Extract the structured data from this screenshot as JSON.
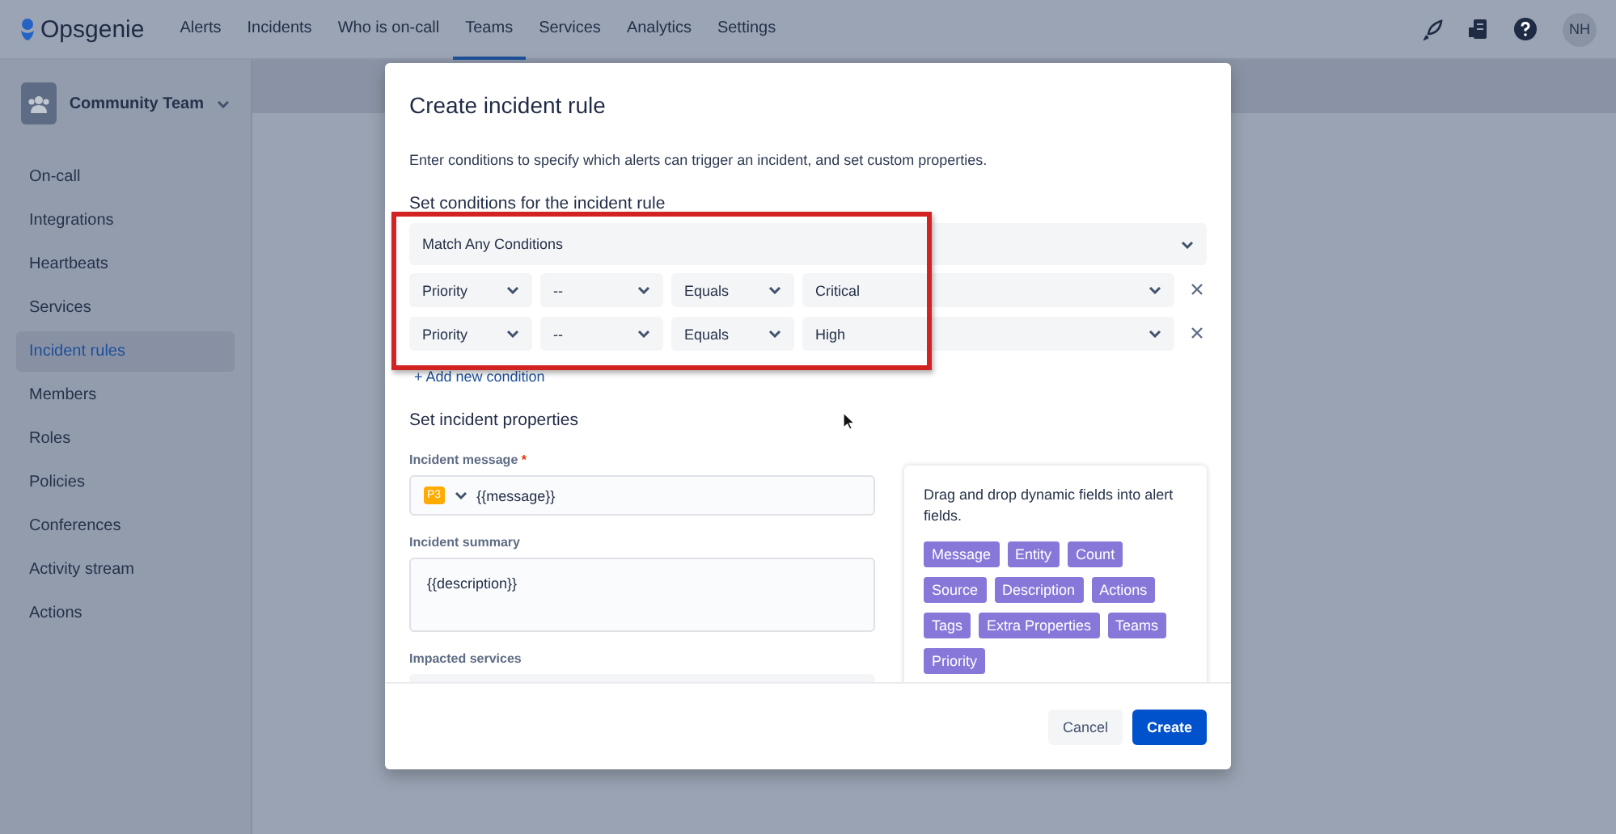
{
  "nav": {
    "brand": "Opsgenie",
    "items": [
      {
        "label": "Alerts",
        "selected": false
      },
      {
        "label": "Incidents",
        "selected": false
      },
      {
        "label": "Who is on-call",
        "selected": false
      },
      {
        "label": "Teams",
        "selected": true
      },
      {
        "label": "Services",
        "selected": false
      },
      {
        "label": "Analytics",
        "selected": false
      },
      {
        "label": "Settings",
        "selected": false
      }
    ],
    "avatar": "NH"
  },
  "sidebar": {
    "team": "Community Team",
    "items": [
      {
        "label": "On-call",
        "selected": false
      },
      {
        "label": "Integrations",
        "selected": false
      },
      {
        "label": "Heartbeats",
        "selected": false
      },
      {
        "label": "Services",
        "selected": false
      },
      {
        "label": "Incident rules",
        "selected": true
      },
      {
        "label": "Members",
        "selected": false
      },
      {
        "label": "Roles",
        "selected": false
      },
      {
        "label": "Policies",
        "selected": false
      },
      {
        "label": "Conferences",
        "selected": false
      },
      {
        "label": "Activity stream",
        "selected": false
      },
      {
        "label": "Actions",
        "selected": false
      }
    ]
  },
  "dialog": {
    "title": "Create incident rule",
    "description": "Enter conditions to specify which alerts can trigger an incident, and set custom properties.",
    "conditions_heading": "Set conditions for the incident rule",
    "match": "Match Any Conditions",
    "conditions": [
      {
        "field": "Priority",
        "key": "--",
        "operator": "Equals",
        "value": "Critical"
      },
      {
        "field": "Priority",
        "key": "--",
        "operator": "Equals",
        "value": "High"
      }
    ],
    "add_condition": "+ Add new condition",
    "properties_heading": "Set incident properties",
    "message_label": "Incident message",
    "message_required_mark": "*",
    "priority_badge": "P3",
    "message_value": "{{message}}",
    "summary_label": "Incident summary",
    "summary_value": "{{description}}",
    "services_label": "Impacted services",
    "hint": "Drag and drop dynamic fields into alert fields.",
    "dynamic_fields": [
      "Message",
      "Entity",
      "Count",
      "Source",
      "Description",
      "Actions",
      "Tags",
      "Extra Properties",
      "Teams",
      "Priority"
    ],
    "buttons": [
      {
        "label": "Cancel",
        "kind": "subtle"
      },
      {
        "label": "Create",
        "kind": "primary"
      }
    ]
  }
}
